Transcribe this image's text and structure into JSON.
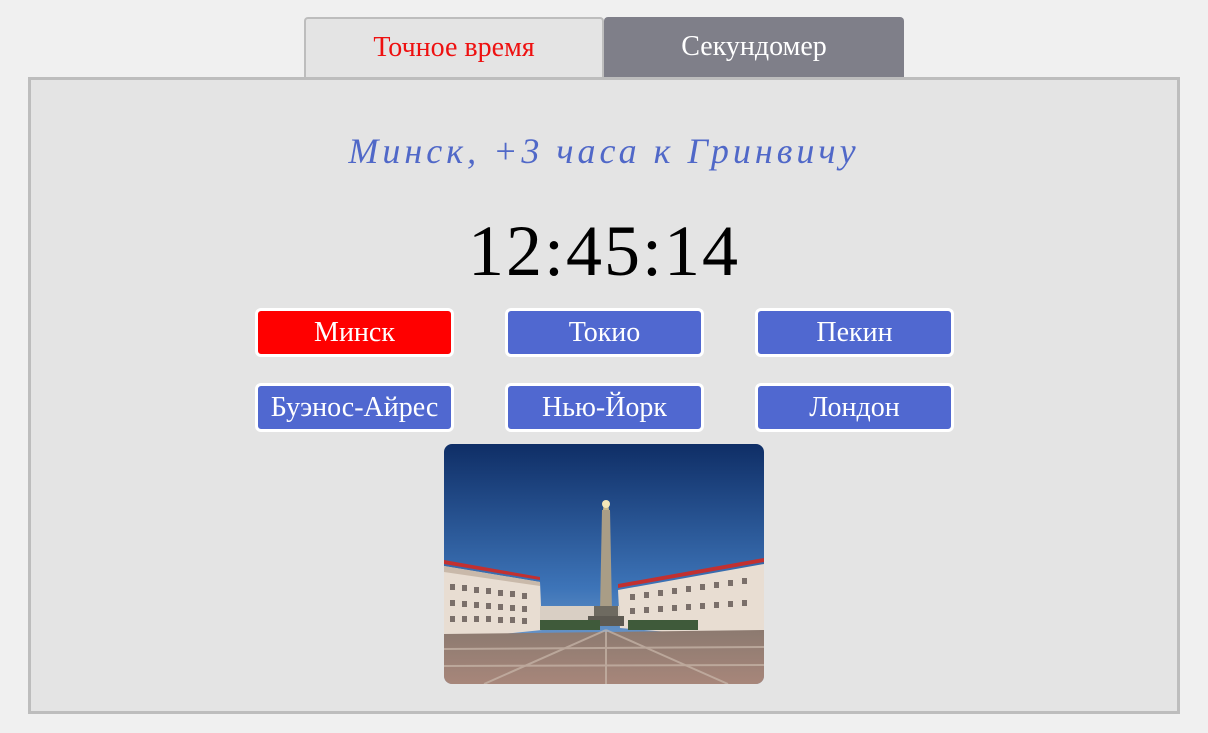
{
  "tabs": [
    {
      "label": "Точное время",
      "active": true
    },
    {
      "label": "Секундомер",
      "active": false
    }
  ],
  "zone": {
    "title": "Минск, +3 часа к Гринвичу"
  },
  "clock": {
    "time": "12:45:14"
  },
  "cities": [
    {
      "label": "Минск",
      "selected": true
    },
    {
      "label": "Токио",
      "selected": false
    },
    {
      "label": "Пекин",
      "selected": false
    },
    {
      "label": "Буэнос-Айрес",
      "selected": false
    },
    {
      "label": "Нью-Йорк",
      "selected": false
    },
    {
      "label": "Лондон",
      "selected": false
    }
  ],
  "colors": {
    "accent_blue": "#5068d0",
    "selected_red": "#ff0000",
    "tab_active_text": "#ee1111",
    "tab_inactive_bg": "#7f7f89",
    "title_blue": "#5068c8"
  }
}
